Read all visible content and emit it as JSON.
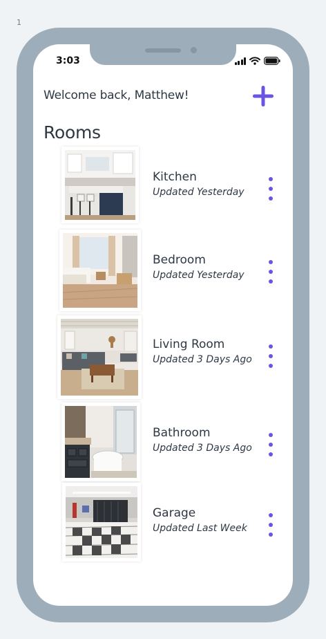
{
  "artboard": {
    "label": "1"
  },
  "status_bar": {
    "time": "3:03"
  },
  "header": {
    "welcome_text": "Welcome back, Matthew!",
    "add_icon": "plus-icon"
  },
  "rooms": {
    "title": "Rooms",
    "items": [
      {
        "name": "Kitchen",
        "updated": "Updated Yesterday",
        "image": "kitchen-photo"
      },
      {
        "name": "Bedroom",
        "updated": "Updated Yesterday",
        "image": "bedroom-photo"
      },
      {
        "name": "Living Room",
        "updated": "Updated 3 Days Ago",
        "image": "living-room-photo"
      },
      {
        "name": "Bathroom",
        "updated": "Updated 3 Days Ago",
        "image": "bathroom-photo"
      },
      {
        "name": "Garage",
        "updated": "Updated Last Week",
        "image": "garage-photo"
      }
    ]
  },
  "colors": {
    "accent": "#6a55e0",
    "text": "#2e3844",
    "phone_frame": "#9dadba"
  }
}
